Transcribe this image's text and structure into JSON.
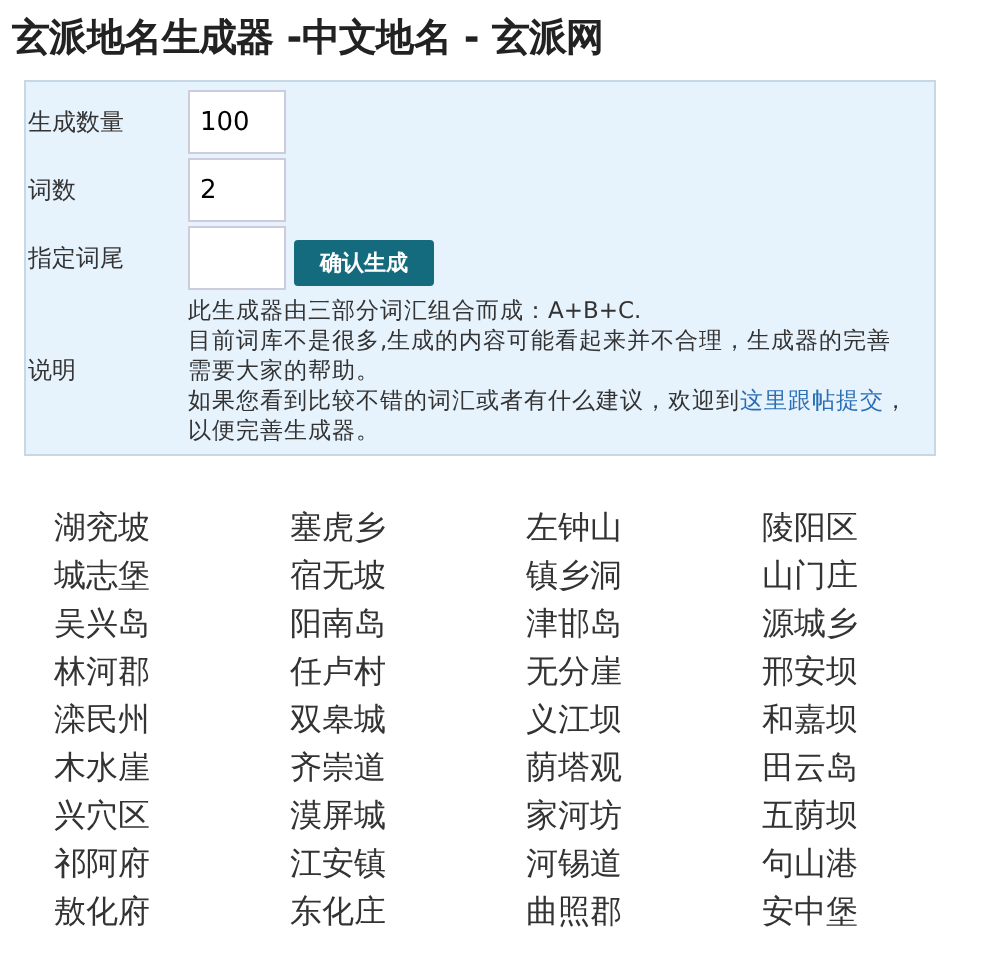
{
  "title": "玄派地名生成器 -中文地名 - 玄派网",
  "form": {
    "fields": [
      {
        "label": "生成数量",
        "value": "100"
      },
      {
        "label": "词数",
        "value": "2"
      },
      {
        "label": "指定词尾"
      }
    ],
    "submit": "确认生成",
    "note_label": "说明",
    "note_lines": [
      {
        "text": "此生成器由三部分词汇组合而成：A+B+C."
      },
      {
        "text": "目前词库不是很多,生成的内容可能看起来并不合理，生成器的完善需要大家的帮助。"
      },
      {
        "text": "如果您看到比较不错的词汇或者有什么建议，欢迎到",
        "link": "这里跟帖提交",
        "after": "，以便完善生成器。"
      }
    ]
  },
  "names": [
    "湖兖坡",
    "塞虎乡",
    "左钟山",
    "陵阳区",
    "城志堡",
    "宿无坡",
    "镇乡洞",
    "山门庄",
    "吴兴岛",
    "阳南岛",
    "津邯岛",
    "源城乡",
    "林河郡",
    "任卢村",
    "无分崖",
    "邢安坝",
    "滦民州",
    "双皋城",
    "义江坝",
    "和嘉坝",
    "木水崖",
    "齐崇道",
    "荫塔观",
    "田云岛",
    "兴穴区",
    "漠屏城",
    "家河坊",
    "五荫坝",
    "祁阿府",
    "江安镇",
    "河锡道",
    "句山港",
    "敖化府",
    "东化庄",
    "曲照郡",
    "安中堡"
  ]
}
